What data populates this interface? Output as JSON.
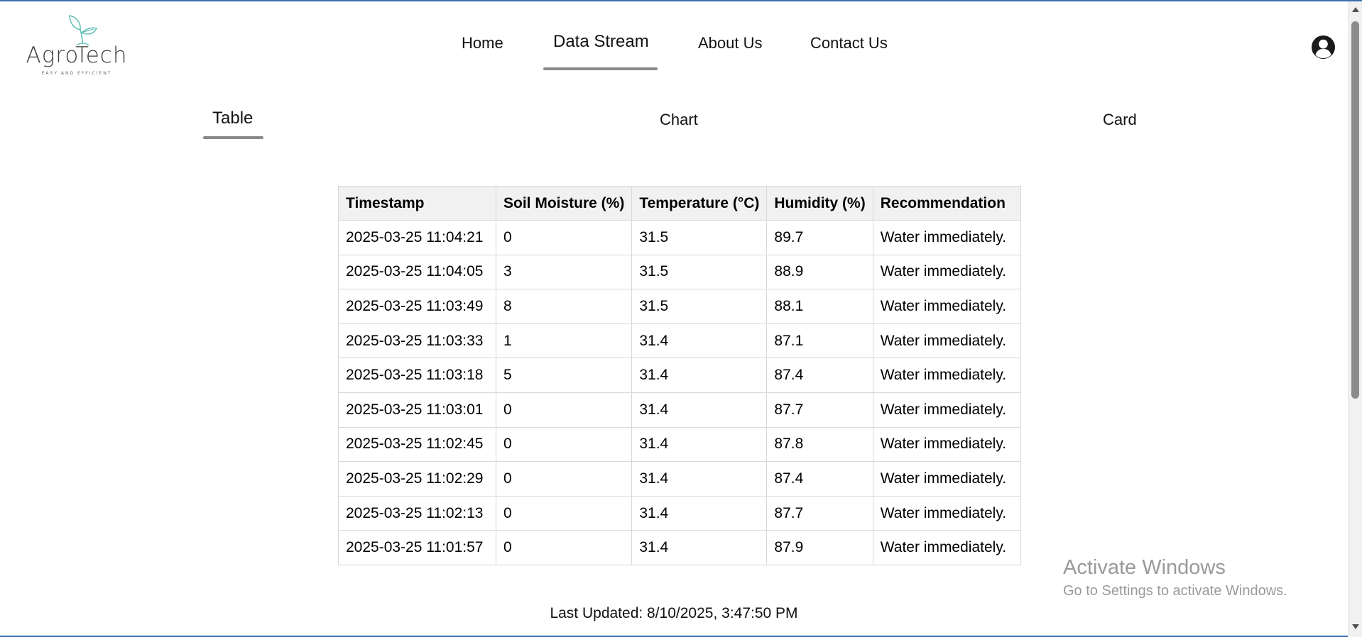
{
  "brand": {
    "name": "AgroTech",
    "tagline": "EASY AND EFFICIENT"
  },
  "nav": {
    "items": [
      {
        "label": "Home"
      },
      {
        "label": "Data Stream"
      },
      {
        "label": "About Us"
      },
      {
        "label": "Contact Us"
      }
    ],
    "active": "Data Stream"
  },
  "tabs": {
    "items": [
      {
        "label": "Table"
      },
      {
        "label": "Chart"
      },
      {
        "label": "Card"
      }
    ],
    "active": "Table"
  },
  "table": {
    "headers": [
      "Timestamp",
      "Soil Moisture (%)",
      "Temperature (°C)",
      "Humidity (%)",
      "Recommendation"
    ],
    "rows": [
      [
        "2025-03-25 11:04:21",
        "0",
        "31.5",
        "89.7",
        "Water immediately."
      ],
      [
        "2025-03-25 11:04:05",
        "3",
        "31.5",
        "88.9",
        "Water immediately."
      ],
      [
        "2025-03-25 11:03:49",
        "8",
        "31.5",
        "88.1",
        "Water immediately."
      ],
      [
        "2025-03-25 11:03:33",
        "1",
        "31.4",
        "87.1",
        "Water immediately."
      ],
      [
        "2025-03-25 11:03:18",
        "5",
        "31.4",
        "87.4",
        "Water immediately."
      ],
      [
        "2025-03-25 11:03:01",
        "0",
        "31.4",
        "87.7",
        "Water immediately."
      ],
      [
        "2025-03-25 11:02:45",
        "0",
        "31.4",
        "87.8",
        "Water immediately."
      ],
      [
        "2025-03-25 11:02:29",
        "0",
        "31.4",
        "87.4",
        "Water immediately."
      ],
      [
        "2025-03-25 11:02:13",
        "0",
        "31.4",
        "87.7",
        "Water immediately."
      ],
      [
        "2025-03-25 11:01:57",
        "0",
        "31.4",
        "87.9",
        "Water immediately."
      ]
    ]
  },
  "status": {
    "last_updated": "Last Updated: 8/10/2025, 3:47:50 PM"
  },
  "watermark": {
    "title": "Activate Windows",
    "subtitle": "Go to Settings to activate Windows."
  },
  "icons": {
    "user": "user-account-icon",
    "logo": "sprout-icon"
  },
  "colors": {
    "logo_leaf": "#5fbfb7",
    "active_underline": "#8a8a8a",
    "header_bg": "#f1f1f1",
    "border": "#d8d8d8"
  }
}
